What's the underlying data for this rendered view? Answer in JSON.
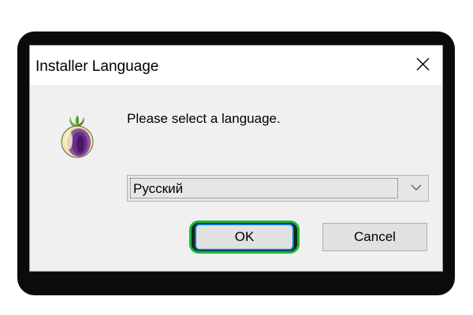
{
  "window": {
    "title": "Installer Language",
    "close_icon": "close-icon"
  },
  "dialog": {
    "logo_icon": "tor-onion-icon",
    "prompt": "Please select a language.",
    "language_select": {
      "selected": "Русский",
      "dropdown_icon": "chevron-down-icon"
    },
    "buttons": {
      "ok_label": "OK",
      "cancel_label": "Cancel"
    }
  },
  "colors": {
    "focus_highlight": "#1db33b",
    "default_button_border": "#0078d7",
    "dialog_background": "#f0f0f0"
  }
}
